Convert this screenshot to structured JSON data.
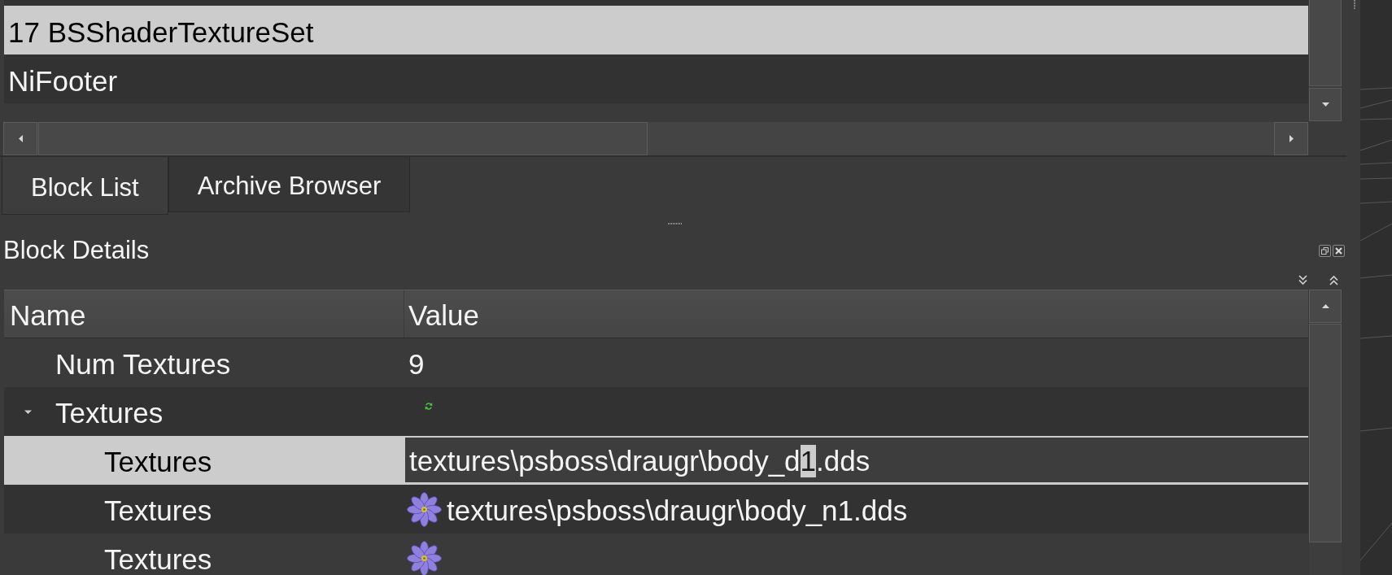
{
  "block_list": {
    "rows": [
      {
        "text": "17 BSShaderTextureSet",
        "selected": true
      },
      {
        "text": "NiFooter",
        "selected": false
      }
    ]
  },
  "dock_tabs": [
    {
      "label": "Block List",
      "selected": true
    },
    {
      "label": "Archive Browser",
      "selected": false
    }
  ],
  "block_details": {
    "title": "Block Details",
    "columns": [
      "Name",
      "Value"
    ],
    "rows": [
      {
        "name": "Num Textures",
        "kind": "number",
        "value": "9",
        "selected": false
      },
      {
        "name": "Textures",
        "kind": "array",
        "selected": false,
        "expanded": true,
        "children": [
          {
            "name": "Textures",
            "kind": "editor",
            "selected": true,
            "value_parts": [
              {
                "text": "textures\\psboss\\draugr\\body_d",
                "selected": false
              },
              {
                "text": "1",
                "selected": true
              },
              {
                "text": ".dds",
                "selected": false
              }
            ]
          },
          {
            "name": "Textures",
            "kind": "texture",
            "selected": false,
            "value": "textures\\psboss\\draugr\\body_n1.dds"
          },
          {
            "name": "Textures",
            "kind": "texture",
            "selected": false
          }
        ]
      }
    ]
  }
}
